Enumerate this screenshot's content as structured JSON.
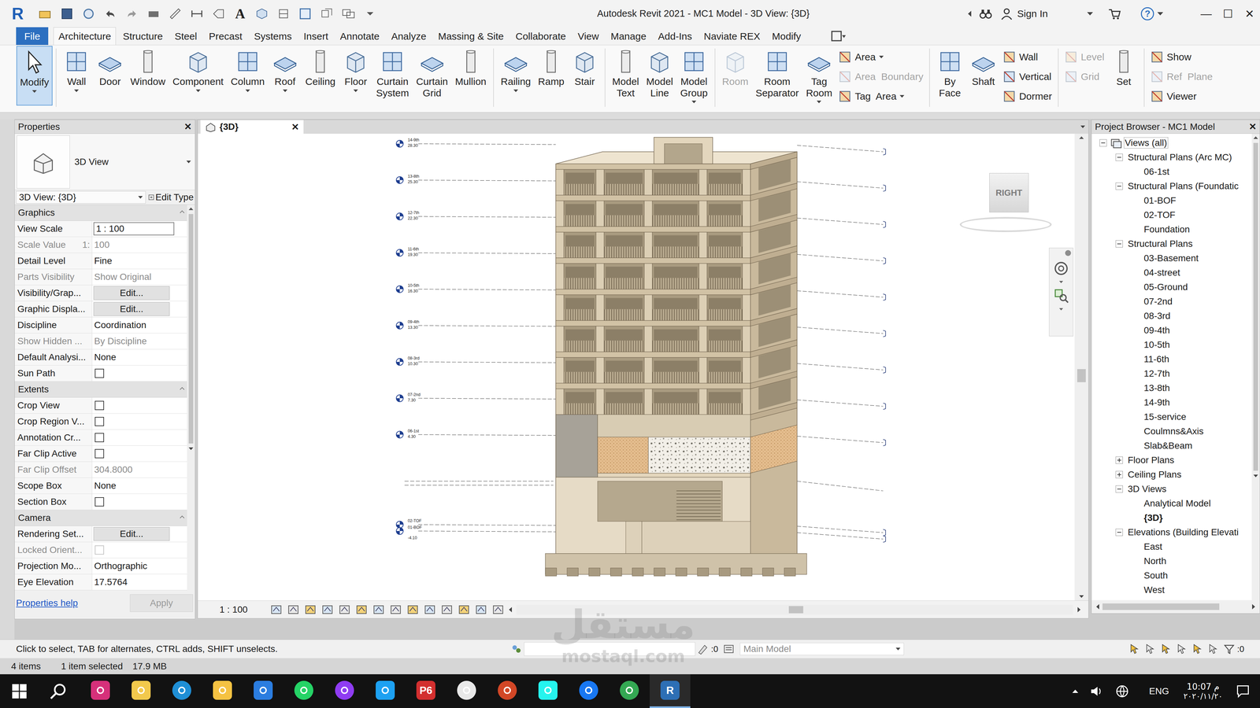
{
  "window": {
    "title": "Autodesk Revit 2021 - MC1 Model - 3D View: {3D}",
    "app_logo": "R",
    "controls": [
      "—",
      "☐",
      "✕"
    ]
  },
  "quick_access": {
    "text_tool": "A"
  },
  "account": {
    "sign_in": "Sign In",
    "help": "?"
  },
  "ribbon_tabs": [
    {
      "label": "File",
      "selected": false
    },
    {
      "label": "Architecture",
      "selected": true
    },
    {
      "label": "Structure",
      "selected": false
    },
    {
      "label": "Steel",
      "selected": false
    },
    {
      "label": "Precast",
      "selected": false
    },
    {
      "label": "Systems",
      "selected": false
    },
    {
      "label": "Insert",
      "selected": false
    },
    {
      "label": "Annotate",
      "selected": false
    },
    {
      "label": "Analyze",
      "selected": false
    },
    {
      "label": "Massing & Site",
      "selected": false
    },
    {
      "label": "Collaborate",
      "selected": false
    },
    {
      "label": "View",
      "selected": false
    },
    {
      "label": "Manage",
      "selected": false
    },
    {
      "label": "Add-Ins",
      "selected": false
    },
    {
      "label": "Naviate REX",
      "selected": false
    },
    {
      "label": "Modify",
      "selected": false
    }
  ],
  "ribbon_groups": [
    {
      "items": [
        {
          "kind": "large",
          "label": "Modify",
          "selected": true,
          "disabled": false,
          "menu": true
        }
      ]
    },
    {
      "items": [
        {
          "kind": "large",
          "label": "Wall",
          "selected": false,
          "disabled": false,
          "menu": true
        },
        {
          "kind": "large",
          "label": "Door",
          "selected": false,
          "disabled": false,
          "menu": false
        },
        {
          "kind": "large",
          "label": "Window",
          "selected": false,
          "disabled": false,
          "menu": false
        },
        {
          "kind": "large",
          "label": "Component",
          "selected": false,
          "disabled": false,
          "menu": true
        },
        {
          "kind": "large",
          "label": "Column",
          "selected": false,
          "disabled": false,
          "menu": true
        },
        {
          "kind": "large",
          "label": "Roof",
          "selected": false,
          "disabled": false,
          "menu": true
        },
        {
          "kind": "large",
          "label": "Ceiling",
          "selected": false,
          "disabled": false,
          "menu": false
        },
        {
          "kind": "large",
          "label": "Floor",
          "selected": false,
          "disabled": false,
          "menu": true
        },
        {
          "kind": "large",
          "label": "Curtain System",
          "selected": false,
          "disabled": false,
          "menu": false
        },
        {
          "kind": "large",
          "label": "Curtain Grid",
          "selected": false,
          "disabled": false,
          "menu": false
        },
        {
          "kind": "large",
          "label": "Mullion",
          "selected": false,
          "disabled": false,
          "menu": false
        }
      ]
    },
    {
      "items": [
        {
          "kind": "large",
          "label": "Railing",
          "selected": false,
          "disabled": false,
          "menu": true
        },
        {
          "kind": "large",
          "label": "Ramp",
          "selected": false,
          "disabled": false,
          "menu": false
        },
        {
          "kind": "large",
          "label": "Stair",
          "selected": false,
          "disabled": false,
          "menu": false
        }
      ]
    },
    {
      "items": [
        {
          "kind": "large",
          "label": "Model Text",
          "selected": false,
          "disabled": false,
          "menu": false
        },
        {
          "kind": "large",
          "label": "Model Line",
          "selected": false,
          "disabled": false,
          "menu": false
        },
        {
          "kind": "large",
          "label": "Model Group",
          "selected": false,
          "disabled": false,
          "menu": true
        }
      ]
    },
    {
      "items": [
        {
          "kind": "large",
          "label": "Room",
          "selected": false,
          "disabled": true,
          "menu": false
        },
        {
          "kind": "large",
          "label": "Room Separator",
          "selected": false,
          "disabled": false,
          "menu": false
        },
        {
          "kind": "large",
          "label": "Tag Room",
          "selected": false,
          "disabled": false,
          "menu": true
        },
        {
          "kind": "stack",
          "tools": [
            {
              "label": "Area",
              "selected": false,
              "disabled": false,
              "menu": true
            },
            {
              "label": "Area  Boundary",
              "selected": false,
              "disabled": true,
              "menu": false
            },
            {
              "label": "Tag  Area",
              "selected": false,
              "disabled": false,
              "menu": true
            }
          ]
        }
      ]
    },
    {
      "items": [
        {
          "kind": "large",
          "label": "By Face",
          "selected": false,
          "disabled": false,
          "menu": false
        },
        {
          "kind": "large",
          "label": "Shaft",
          "selected": false,
          "disabled": false,
          "menu": false
        },
        {
          "kind": "stack",
          "tools": [
            {
              "label": "Wall",
              "selected": false,
              "disabled": false,
              "menu": false
            },
            {
              "label": "Vertical",
              "selected": false,
              "disabled": false,
              "menu": false
            },
            {
              "label": "Dormer",
              "selected": false,
              "disabled": false,
              "menu": false
            }
          ]
        }
      ]
    },
    {
      "items": [
        {
          "kind": "stack",
          "tools": [
            {
              "label": "Level",
              "selected": false,
              "disabled": true,
              "menu": false
            },
            {
              "label": "Grid",
              "selected": false,
              "disabled": true,
              "menu": false
            }
          ]
        },
        {
          "kind": "large",
          "label": "Set",
          "selected": false,
          "disabled": false,
          "menu": false
        }
      ]
    },
    {
      "items": [
        {
          "kind": "stack",
          "tools": [
            {
              "label": "Show",
              "selected": false,
              "disabled": false,
              "menu": false
            },
            {
              "label": "Ref  Plane",
              "selected": false,
              "disabled": true,
              "menu": false
            },
            {
              "label": "Viewer",
              "selected": false,
              "disabled": false,
              "menu": false
            }
          ]
        }
      ]
    }
  ],
  "properties": {
    "title": "Properties",
    "close": "✕",
    "type_name": "3D View",
    "instance": "3D View: {3D}",
    "edit_type": "Edit Type",
    "sections": [
      {
        "title": "Graphics",
        "rows": [
          {
            "label": "View Scale",
            "kind": "input",
            "value": "1 : 100",
            "disabled": false
          },
          {
            "label": "Scale Value",
            "suffix": "1:",
            "kind": "text",
            "value": "100",
            "disabled": true
          },
          {
            "label": "Detail Level",
            "kind": "text",
            "value": "Fine",
            "disabled": false
          },
          {
            "label": "Parts Visibility",
            "kind": "text",
            "value": "Show Original",
            "disabled": true
          },
          {
            "label": "Visibility/Grap...",
            "kind": "button",
            "value": "Edit...",
            "disabled": false
          },
          {
            "label": "Graphic Displa...",
            "kind": "button",
            "value": "Edit...",
            "disabled": false
          },
          {
            "label": "Discipline",
            "kind": "text",
            "value": "Coordination",
            "disabled": false
          },
          {
            "label": "Show Hidden ...",
            "kind": "text",
            "value": "By Discipline",
            "disabled": true
          },
          {
            "label": "Default Analysi...",
            "kind": "text",
            "value": "None",
            "disabled": false
          },
          {
            "label": "Sun Path",
            "kind": "checkbox",
            "checked": false,
            "disabled": false
          }
        ]
      },
      {
        "title": "Extents",
        "rows": [
          {
            "label": "Crop View",
            "kind": "checkbox",
            "checked": false,
            "disabled": false
          },
          {
            "label": "Crop Region V...",
            "kind": "checkbox",
            "checked": false,
            "disabled": false
          },
          {
            "label": "Annotation Cr...",
            "kind": "checkbox",
            "checked": false,
            "disabled": false
          },
          {
            "label": "Far Clip Active",
            "kind": "checkbox",
            "checked": false,
            "disabled": false
          },
          {
            "label": "Far Clip Offset",
            "kind": "text",
            "value": "304.8000",
            "disabled": true
          },
          {
            "label": "Scope Box",
            "kind": "text",
            "value": "None",
            "disabled": false
          },
          {
            "label": "Section Box",
            "kind": "checkbox",
            "checked": false,
            "disabled": false
          }
        ]
      },
      {
        "title": "Camera",
        "rows": [
          {
            "label": "Rendering Set...",
            "kind": "button",
            "value": "Edit...",
            "disabled": false
          },
          {
            "label": "Locked Orient...",
            "kind": "checkbox",
            "checked": false,
            "disabled": true
          },
          {
            "label": "Projection Mo...",
            "kind": "text",
            "value": "Orthographic",
            "disabled": false
          },
          {
            "label": "Eye Elevation",
            "kind": "text",
            "value": "17.5764",
            "disabled": false
          }
        ]
      }
    ],
    "help": "Properties help",
    "apply": "Apply",
    "apply_disabled": true
  },
  "view": {
    "tab": "{3D}",
    "tab_close": "✕",
    "viewcube": "RIGHT",
    "scale": "1 : 100",
    "levels": [
      {
        "name": "14-9th",
        "elevation": "28.30"
      },
      {
        "name": "13-8th",
        "elevation": "25.30"
      },
      {
        "name": "12-7th",
        "elevation": "22.30"
      },
      {
        "name": "11-6th",
        "elevation": "19.30"
      },
      {
        "name": "10-5th",
        "elevation": "16.30"
      },
      {
        "name": "09-4th",
        "elevation": "13.30"
      },
      {
        "name": "08-3rd",
        "elevation": "10.30"
      },
      {
        "name": "07-2nd",
        "elevation": "7.30"
      },
      {
        "name": "06-1st",
        "elevation": "4.30"
      },
      {
        "name": "02-TOF"
      },
      {
        "name": "01-BOF",
        "elevation": "-4.10"
      }
    ]
  },
  "browser": {
    "title": "Project Browser - MC1 Model",
    "close": "✕",
    "items": [
      {
        "label": "Views (all)",
        "level": 0,
        "kind": "folder",
        "expanded": true,
        "selected": true,
        "current": false
      },
      {
        "label": "Structural Plans (Arc MC)",
        "level": 1,
        "kind": "folder",
        "expanded": true,
        "selected": false,
        "current": false
      },
      {
        "label": "06-1st",
        "level": 2,
        "kind": "view",
        "expanded": false,
        "selected": false,
        "current": false
      },
      {
        "label": "Structural Plans (Foundatic",
        "level": 1,
        "kind": "folder",
        "expanded": true,
        "selected": false,
        "current": false
      },
      {
        "label": "01-BOF",
        "level": 2,
        "kind": "view",
        "expanded": false,
        "selected": false,
        "current": false
      },
      {
        "label": "02-TOF",
        "level": 2,
        "kind": "view",
        "expanded": false,
        "selected": false,
        "current": false
      },
      {
        "label": "Foundation",
        "level": 2,
        "kind": "view",
        "expanded": false,
        "selected": false,
        "current": false
      },
      {
        "label": "Structural Plans",
        "level": 1,
        "kind": "folder",
        "expanded": true,
        "selected": false,
        "current": false
      },
      {
        "label": "03-Basement",
        "level": 2,
        "kind": "view",
        "expanded": false,
        "selected": false,
        "current": false
      },
      {
        "label": "04-street",
        "level": 2,
        "kind": "view",
        "expanded": false,
        "selected": false,
        "current": false
      },
      {
        "label": "05-Ground",
        "level": 2,
        "kind": "view",
        "expanded": false,
        "selected": false,
        "current": false
      },
      {
        "label": "07-2nd",
        "level": 2,
        "kind": "view",
        "expanded": false,
        "selected": false,
        "current": false
      },
      {
        "label": "08-3rd",
        "level": 2,
        "kind": "view",
        "expanded": false,
        "selected": false,
        "current": false
      },
      {
        "label": "09-4th",
        "level": 2,
        "kind": "view",
        "expanded": false,
        "selected": false,
        "current": false
      },
      {
        "label": "10-5th",
        "level": 2,
        "kind": "view",
        "expanded": false,
        "selected": false,
        "current": false
      },
      {
        "label": "11-6th",
        "level": 2,
        "kind": "view",
        "expanded": false,
        "selected": false,
        "current": false
      },
      {
        "label": "12-7th",
        "level": 2,
        "kind": "view",
        "expanded": false,
        "selected": false,
        "current": false
      },
      {
        "label": "13-8th",
        "level": 2,
        "kind": "view",
        "expanded": false,
        "selected": false,
        "current": false
      },
      {
        "label": "14-9th",
        "level": 2,
        "kind": "view",
        "expanded": false,
        "selected": false,
        "current": false
      },
      {
        "label": "15-service",
        "level": 2,
        "kind": "view",
        "expanded": false,
        "selected": false,
        "current": false
      },
      {
        "label": "Coulmns&Axis",
        "level": 2,
        "kind": "view",
        "expanded": false,
        "selected": false,
        "current": false
      },
      {
        "label": "Slab&Beam",
        "level": 2,
        "kind": "view",
        "expanded": false,
        "selected": false,
        "current": false
      },
      {
        "label": "Floor Plans",
        "level": 1,
        "kind": "folder",
        "expanded": false,
        "selected": false,
        "current": false
      },
      {
        "label": "Ceiling Plans",
        "level": 1,
        "kind": "folder",
        "expanded": false,
        "selected": false,
        "current": false
      },
      {
        "label": "3D Views",
        "level": 1,
        "kind": "folder",
        "expanded": true,
        "selected": false,
        "current": false
      },
      {
        "label": "Analytical Model",
        "level": 2,
        "kind": "view",
        "expanded": false,
        "selected": false,
        "current": false
      },
      {
        "label": "{3D}",
        "level": 2,
        "kind": "view",
        "expanded": false,
        "selected": false,
        "current": true
      },
      {
        "label": "Elevations (Building Elevati",
        "level": 1,
        "kind": "folder",
        "expanded": true,
        "selected": false,
        "current": false
      },
      {
        "label": "East",
        "level": 2,
        "kind": "view",
        "expanded": false,
        "selected": false,
        "current": false
      },
      {
        "label": "North",
        "level": 2,
        "kind": "view",
        "expanded": false,
        "selected": false,
        "current": false
      },
      {
        "label": "South",
        "level": 2,
        "kind": "view",
        "expanded": false,
        "selected": false,
        "current": false
      },
      {
        "label": "West",
        "level": 2,
        "kind": "view",
        "expanded": false,
        "selected": false,
        "current": false
      }
    ]
  },
  "status": {
    "hint": "Click to select, TAB for alternates, CTRL adds, SHIFT unselects.",
    "workset_count": ":0",
    "model": "Main Model",
    "filter_count": ":0",
    "items": "4 items",
    "selection": "1 item selected",
    "memory": "17.9 MB"
  },
  "taskbar": {
    "apps": [
      {
        "kind": "instagram",
        "color": "#d6307a",
        "active": false
      },
      {
        "kind": "pen",
        "color": "#f2c94c",
        "active": false
      },
      {
        "kind": "edge",
        "color": "#1f8fd6",
        "active": false
      },
      {
        "kind": "explorer",
        "color": "#f5c242",
        "active": false
      },
      {
        "kind": "store",
        "color": "#2b7de0",
        "active": false
      },
      {
        "kind": "whatsapp",
        "color": "#25d366",
        "active": false
      },
      {
        "kind": "messenger",
        "color": "#8f3cf2",
        "active": false
      },
      {
        "kind": "twitter",
        "color": "#1da1f2",
        "active": false
      },
      {
        "kind": "p6",
        "label": "P6",
        "color": "#d32f2f",
        "active": false
      },
      {
        "kind": "chatgpt",
        "color": "#e8e8e8",
        "active": false
      },
      {
        "kind": "powerpoint",
        "color": "#d24726",
        "active": false
      },
      {
        "kind": "tiktok",
        "color": "#25f4ee",
        "active": false
      },
      {
        "kind": "facebook",
        "color": "#1877f2",
        "active": false
      },
      {
        "kind": "chrome",
        "color": "#34a853",
        "active": false
      },
      {
        "kind": "revit",
        "label": "R",
        "color": "#2d6fb5",
        "active": true
      }
    ],
    "language": "ENG",
    "time": "10:07 م",
    "date": "٢٠٢٠/١١/٢٠"
  },
  "watermark": {
    "arabic": "مستقل",
    "latin": "mostaql.com"
  }
}
